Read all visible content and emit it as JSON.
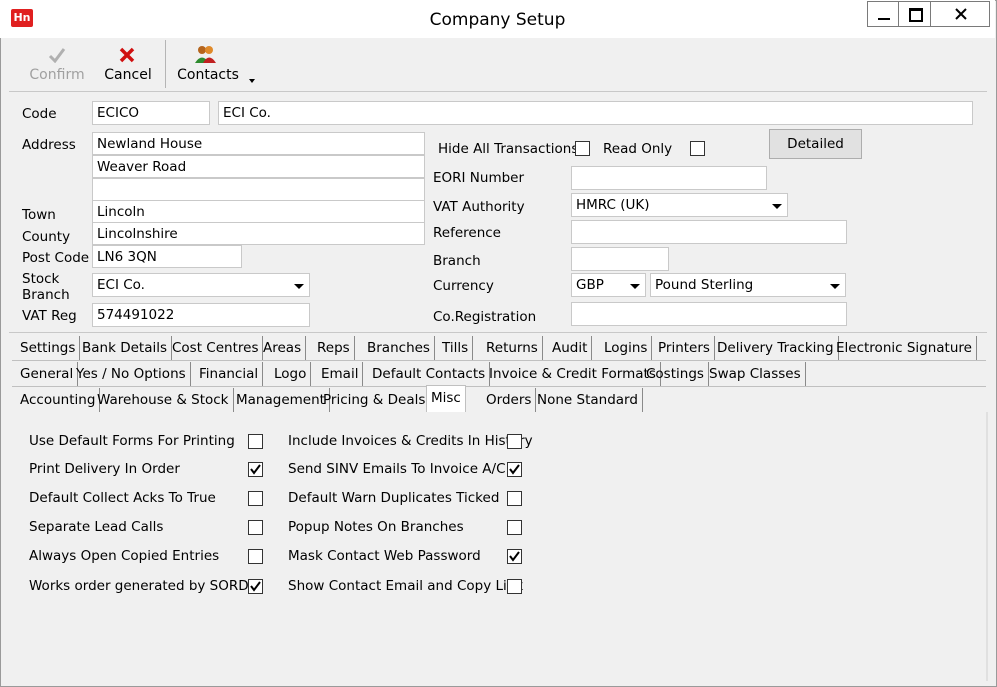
{
  "window": {
    "title": "Company Setup",
    "app_icon_text": "Hn"
  },
  "toolbar": {
    "confirm_label": "Confirm",
    "cancel_label": "Cancel",
    "contacts_label": "Contacts"
  },
  "form": {
    "code_label": "Code",
    "code_value": "ECICO",
    "name_value": "ECI Co.",
    "address_label": "Address",
    "address_line1": "Newland House",
    "address_line2": "Weaver Road",
    "address_line3": "",
    "town_label": "Town",
    "town_value": "Lincoln",
    "county_label": "County",
    "county_value": "Lincolnshire",
    "postcode_label": "Post Code",
    "postcode_value": "LN6 3QN",
    "stock_branch_label_1": "Stock",
    "stock_branch_label_2": "Branch",
    "stock_branch_value": "ECI Co.",
    "vat_reg_label": "VAT Reg",
    "vat_reg_value": "574491022",
    "hide_all_label": "Hide All Transactions",
    "read_only_label": "Read Only",
    "detailed_label": "Detailed",
    "eori_label": "EORI Number",
    "eori_value": "",
    "vat_authority_label": "VAT Authority",
    "vat_authority_value": "HMRC (UK)",
    "reference_label": "Reference",
    "reference_value": "",
    "branch_label": "Branch",
    "branch_value": "",
    "currency_label": "Currency",
    "currency_code": "GBP",
    "currency_name": "Pound Sterling",
    "coreg_label": "Co.Registration",
    "coreg_value": ""
  },
  "tabs": {
    "row1": [
      "Settings",
      "Bank Details",
      "Cost Centres",
      "Areas",
      "Reps",
      "Branches",
      "Tills",
      "Returns",
      "Audit",
      "Logins",
      "Printers",
      "Delivery Tracking",
      "Electronic Signature"
    ],
    "row2": [
      "General",
      "Yes / No Options",
      "Financial",
      "Logo",
      "Email",
      "Default Contacts",
      "Invoice & Credit Formats",
      "Costings",
      "Swap Classes"
    ],
    "row3": [
      "Accounting",
      "Warehouse & Stock",
      "Management",
      "Pricing & Deals",
      "Misc",
      "Orders",
      "None Standard"
    ],
    "selected": "Misc"
  },
  "options": {
    "left": [
      {
        "label": "Use Default Forms For Printing",
        "checked": false
      },
      {
        "label": "Print Delivery In Order",
        "checked": true
      },
      {
        "label": "Default Collect Acks To True",
        "checked": false
      },
      {
        "label": "Separate Lead Calls",
        "checked": false
      },
      {
        "label": "Always Open Copied Entries",
        "checked": false
      },
      {
        "label": "Works order generated by SORD",
        "checked": true
      }
    ],
    "right": [
      {
        "label": "Include Invoices & Credits In History",
        "checked": false
      },
      {
        "label": "Send SINV Emails To Invoice A/C",
        "checked": true
      },
      {
        "label": "Default Warn Duplicates Ticked",
        "checked": false
      },
      {
        "label": "Popup Notes On Branches",
        "checked": false
      },
      {
        "label": "Mask Contact Web Password",
        "checked": true
      },
      {
        "label": "Show Contact Email and Copy Link",
        "checked": false
      }
    ]
  }
}
